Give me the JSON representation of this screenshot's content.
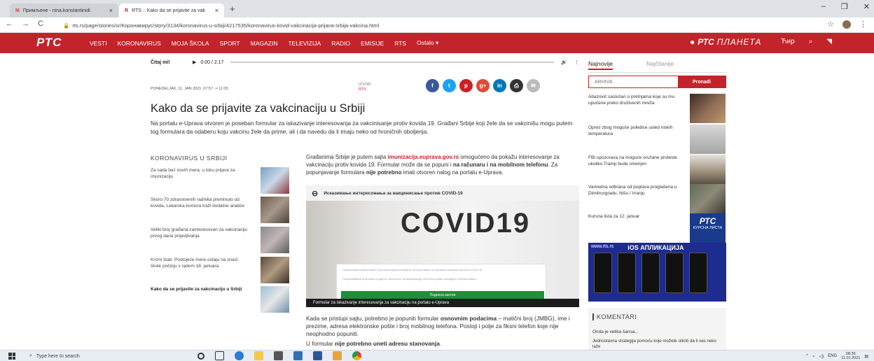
{
  "browser": {
    "tab1": "Примљене - nina.konstantinidi",
    "tab2": "RTS :: Kako da se prijavite za vak",
    "new_tab": "+",
    "url": "rts.rs/page/stories/sr/Коронавирус/story/3134/koronavirus-u-srbiji/4217535/koronavirus-kovid-vakcinacija-prijava-srbija-vakcina.html"
  },
  "nav": {
    "logo": "РТС",
    "items": [
      "VESTI",
      "KORONAVIRUS",
      "MOJA ŠKOLA",
      "SPORT",
      "MAGAZIN",
      "TELEVIZIJA",
      "RADIO",
      "EMISIJE",
      "RTS",
      "Ostalo"
    ],
    "planeta_a": "РТС",
    "planeta_b": "ПЛАНЕТА",
    "cyr": "Ћир"
  },
  "audio": {
    "label": "Čitaj mi!",
    "time": "0:00 / 2:17"
  },
  "meta": {
    "date": "PONEDELJAK, 11. JAN 2021, 07:57 -> 11:05",
    "izvor_label": "IZVOR:",
    "izvor": "RTS"
  },
  "share_colors": [
    "#3b5998",
    "#1da1f2",
    "#cb2027",
    "#dd4b39",
    "#0077b5",
    "#333333",
    "#bbbbbb"
  ],
  "article": {
    "title": "Kako da se prijavite za vakcinaciju u Srbiji",
    "lead": "Na portalu e-Uprava otvoren je poseban formular za iskazivanje interesovanja za vakcinisanje protiv kovida 19. Građani Srbije koji žele da se vakcinišu mogu putem tog formulara da odaberu koju vakcinu žele da prime, ali i da navedu da li imaju neko od hroničnih oboljenja.",
    "p1_a": "Građanima Srbije je putem sajta ",
    "p1_link": "imunizacija.euprava.gov.rs",
    "p1_b": " omogućeno da pokažu interesovanje za vakcinaciju protiv kovida 19. Formular može da se popuni i ",
    "p1_bold1": "na računaru i na mobilnom telefonu",
    "p1_c": ". Za popunjavanje formulara ",
    "p1_bold2": "nije potrebno",
    "p1_d": " imati otvoren nalog na portalu e-Uprava.",
    "fig_title": "Исказивање интересовања за вакцинисање против COVID-19",
    "fig_big": "COVID19",
    "fig_form_line1": "Попуњавање једноставног упитника којим исказујете интересовање за примање вакцине против COVID-19.",
    "fig_form_line2": "Попуњавањем упитника не дајете сагласност за вакцинацију, већ искључиво исказујете интересовање.",
    "fig_form_button": "Поднеси захтев",
    "fig_caption": "Formular za iskazivanje interesovanja za vakcinaciju na portalu e-Uprava",
    "p2_a": "Kada se pristupi sajtu, potrebno je popuniti formular ",
    "p2_bold": "osnovnim podacima",
    "p2_b": " – matični broj (JMBG), ime i prezime, adresa elektronske pošte i broj mobilnog telefona. Postoji i polje za fiksni telefon koje nije neophodno popuniti.",
    "p3_a": "U formular ",
    "p3_bold": "nije potrebno uneti adresu stanovanja",
    "p3_b": "."
  },
  "related": {
    "heading": "KORONAVIRUS U SRBIJI",
    "items": [
      {
        "text": "Za sada bez novih mera, u toku prijava za imunizaciju",
        "bold": false
      },
      {
        "text": "Skoro 70 zdravstvenih radnika preminulo od kovida, Lekarska komora traži dodatne analize",
        "bold": false
      },
      {
        "text": "Veliki broj građana zainteresovan za vakcinaciju prvog dana prijavljivanja",
        "bold": false
      },
      {
        "text": "Krizni štab: Postojeće mere ostaju na snazi, škole počinju s radom 18. januara",
        "bold": false
      },
      {
        "text": "Kako da se prijavite za vakcinaciju u Srbiji",
        "bold": true
      }
    ]
  },
  "sidebar": {
    "tab_latest": "Najnovije",
    "tab_popular": "Najčitanije",
    "search_placeholder": "ARHIVA",
    "search_button": "Pronađi",
    "items": [
      "Abazović saslušan o pretnjama koje su mu upućene preko društvenih mreža",
      "Oprez zbog moguće poledice usled niskih temperatura",
      "FBI upozorava na moguće oružane proteste ukoliko Tramp bude smenjen",
      "Vanredna odbrana od poplava proglašena u Dimitrovgradu, Nišu i Vranju",
      "Kursna lista za 12. januar"
    ],
    "kurs_logo": "РТС",
    "kurs_sub": "КУРСНА ЛИСТА",
    "ios_site": "www.rts.rs",
    "ios_title": "iOS АПЛИКАЦИЈА",
    "comments_heading": "KOMENTARI",
    "comment1": "Onda je velika šansa...",
    "comment2": "Jednostavna strategija pomoću koje možete otkriti da li vas neko laže"
  },
  "taskbar": {
    "search": "Type here to search",
    "lang": "ENG",
    "time": "08:36",
    "date": "11.01.2021"
  }
}
